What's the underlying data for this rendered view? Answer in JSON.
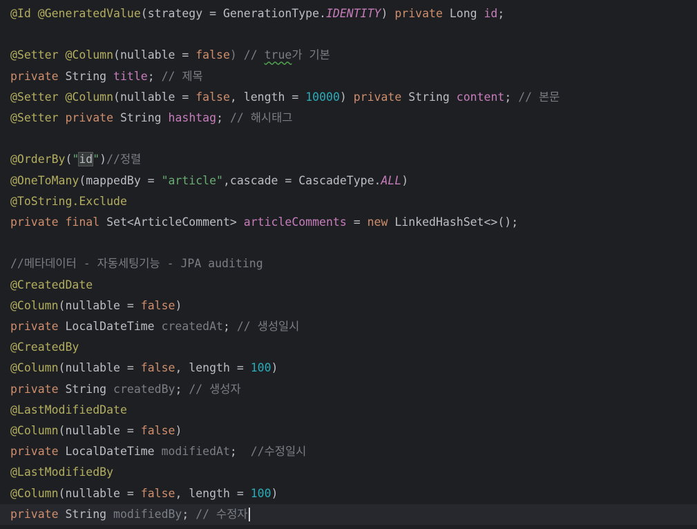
{
  "editor": {
    "lines": [
      {
        "id": "line-id-field",
        "tokens": [
          {
            "text": "@Id",
            "type": "annotation"
          },
          {
            "text": " ",
            "type": "plain"
          },
          {
            "text": "@GeneratedValue",
            "type": "annotation"
          },
          {
            "text": "(strategy = GenerationType.",
            "type": "plain"
          },
          {
            "text": "IDENTITY",
            "type": "static"
          },
          {
            "text": ") ",
            "type": "plain"
          },
          {
            "text": "private",
            "type": "keyword"
          },
          {
            "text": " Long ",
            "type": "plain"
          },
          {
            "text": "id",
            "type": "field"
          },
          {
            "text": ";",
            "type": "plain"
          }
        ]
      },
      {
        "id": "blank-1",
        "tokens": []
      },
      {
        "id": "line-setter-column",
        "tokens": [
          {
            "text": "@Setter",
            "type": "annotation"
          },
          {
            "text": " ",
            "type": "plain"
          },
          {
            "text": "@Column",
            "type": "annotation"
          },
          {
            "text": "(nullable = ",
            "type": "plain"
          },
          {
            "text": "false",
            "type": "keyword"
          },
          {
            "text": ") // ",
            "type": "comment"
          },
          {
            "text": "true",
            "type": "comment",
            "typo": true
          },
          {
            "text": "가 기본",
            "type": "comment"
          }
        ]
      },
      {
        "id": "line-title-field",
        "tokens": [
          {
            "text": "private",
            "type": "keyword"
          },
          {
            "text": " String ",
            "type": "plain"
          },
          {
            "text": "title",
            "type": "field"
          },
          {
            "text": "; ",
            "type": "plain"
          },
          {
            "text": "// 제목",
            "type": "comment"
          }
        ]
      },
      {
        "id": "line-content-field",
        "tokens": [
          {
            "text": "@Setter",
            "type": "annotation"
          },
          {
            "text": " ",
            "type": "plain"
          },
          {
            "text": "@Column",
            "type": "annotation"
          },
          {
            "text": "(nullable = ",
            "type": "plain"
          },
          {
            "text": "false",
            "type": "keyword"
          },
          {
            "text": ", length = ",
            "type": "plain"
          },
          {
            "text": "10000",
            "type": "number"
          },
          {
            "text": ") ",
            "type": "plain"
          },
          {
            "text": "private",
            "type": "keyword"
          },
          {
            "text": " String ",
            "type": "plain"
          },
          {
            "text": "content",
            "type": "field"
          },
          {
            "text": "; ",
            "type": "plain"
          },
          {
            "text": "// 본문",
            "type": "comment"
          }
        ]
      },
      {
        "id": "line-hashtag-field",
        "tokens": [
          {
            "text": "@Setter",
            "type": "annotation"
          },
          {
            "text": " ",
            "type": "plain"
          },
          {
            "text": "private",
            "type": "keyword"
          },
          {
            "text": " String ",
            "type": "plain"
          },
          {
            "text": "hashtag",
            "type": "field"
          },
          {
            "text": "; ",
            "type": "plain"
          },
          {
            "text": "// 해시태그",
            "type": "comment"
          }
        ]
      },
      {
        "id": "blank-2",
        "tokens": []
      },
      {
        "id": "line-orderby",
        "tokens": [
          {
            "text": "@OrderBy",
            "type": "annotation"
          },
          {
            "text": "(",
            "type": "plain"
          },
          {
            "text": "\"",
            "type": "string"
          },
          {
            "text": "id",
            "type": "plain",
            "highlight": true
          },
          {
            "text": "\"",
            "type": "string"
          },
          {
            "text": ")",
            "type": "plain"
          },
          {
            "text": "//정렬",
            "type": "comment"
          }
        ]
      },
      {
        "id": "line-onetomany",
        "tokens": [
          {
            "text": "@OneToMany",
            "type": "annotation"
          },
          {
            "text": "(mappedBy = ",
            "type": "plain"
          },
          {
            "text": "\"article\"",
            "type": "string"
          },
          {
            "text": ",cascade = CascadeType.",
            "type": "plain"
          },
          {
            "text": "ALL",
            "type": "static"
          },
          {
            "text": ")",
            "type": "plain"
          }
        ]
      },
      {
        "id": "line-tostring-exclude",
        "tokens": [
          {
            "text": "@ToString.Exclude",
            "type": "annotation"
          }
        ]
      },
      {
        "id": "line-article-comments",
        "tokens": [
          {
            "text": "private",
            "type": "keyword"
          },
          {
            "text": " ",
            "type": "plain"
          },
          {
            "text": "final",
            "type": "keyword"
          },
          {
            "text": " Set<ArticleComment> ",
            "type": "plain"
          },
          {
            "text": "articleComments",
            "type": "field"
          },
          {
            "text": " = ",
            "type": "plain"
          },
          {
            "text": "new",
            "type": "keyword"
          },
          {
            "text": " LinkedHashSet<>();",
            "type": "plain"
          }
        ]
      },
      {
        "id": "blank-3",
        "tokens": []
      },
      {
        "id": "line-metadata-comment",
        "tokens": [
          {
            "text": "//메타데이터 - 자동세팅기능 - JPA auditing",
            "type": "comment"
          }
        ]
      },
      {
        "id": "line-createddate",
        "tokens": [
          {
            "text": "@CreatedDate",
            "type": "annotation"
          }
        ]
      },
      {
        "id": "line-column-createdat",
        "tokens": [
          {
            "text": "@Column",
            "type": "annotation"
          },
          {
            "text": "(nullable = ",
            "type": "plain"
          },
          {
            "text": "false",
            "type": "keyword"
          },
          {
            "text": ")",
            "type": "plain"
          }
        ]
      },
      {
        "id": "line-createdat-field",
        "tokens": [
          {
            "text": "private",
            "type": "keyword"
          },
          {
            "text": " LocalDateTime ",
            "type": "plain"
          },
          {
            "text": "createdAt",
            "type": "unused"
          },
          {
            "text": "; ",
            "type": "plain"
          },
          {
            "text": "// 생성일시",
            "type": "comment"
          }
        ]
      },
      {
        "id": "line-createdby",
        "tokens": [
          {
            "text": "@CreatedBy",
            "type": "annotation"
          }
        ]
      },
      {
        "id": "line-column-createdby",
        "tokens": [
          {
            "text": "@Column",
            "type": "annotation"
          },
          {
            "text": "(nullable = ",
            "type": "plain"
          },
          {
            "text": "false",
            "type": "keyword"
          },
          {
            "text": ", length = ",
            "type": "plain"
          },
          {
            "text": "100",
            "type": "number"
          },
          {
            "text": ")",
            "type": "plain"
          }
        ]
      },
      {
        "id": "line-createdby-field",
        "tokens": [
          {
            "text": "private",
            "type": "keyword"
          },
          {
            "text": " String ",
            "type": "plain"
          },
          {
            "text": "createdBy",
            "type": "unused"
          },
          {
            "text": "; ",
            "type": "plain"
          },
          {
            "text": "// 생성자",
            "type": "comment"
          }
        ]
      },
      {
        "id": "line-lastmodifieddate",
        "tokens": [
          {
            "text": "@LastModifiedDate",
            "type": "annotation"
          }
        ]
      },
      {
        "id": "line-column-modifiedat",
        "tokens": [
          {
            "text": "@Column",
            "type": "annotation"
          },
          {
            "text": "(nullable = ",
            "type": "plain"
          },
          {
            "text": "false",
            "type": "keyword"
          },
          {
            "text": ")",
            "type": "plain"
          }
        ]
      },
      {
        "id": "line-modifiedat-field",
        "tokens": [
          {
            "text": "private",
            "type": "keyword"
          },
          {
            "text": " LocalDateTime ",
            "type": "plain"
          },
          {
            "text": "modifiedAt",
            "type": "unused"
          },
          {
            "text": ";  ",
            "type": "plain"
          },
          {
            "text": "//수정일시",
            "type": "comment"
          }
        ]
      },
      {
        "id": "line-lastmodifiedby",
        "tokens": [
          {
            "text": "@LastModifiedBy",
            "type": "annotation"
          }
        ]
      },
      {
        "id": "line-column-modifiedby",
        "tokens": [
          {
            "text": "@Column",
            "type": "annotation"
          },
          {
            "text": "(nullable = ",
            "type": "plain"
          },
          {
            "text": "false",
            "type": "keyword"
          },
          {
            "text": ", length = ",
            "type": "plain"
          },
          {
            "text": "100",
            "type": "number"
          },
          {
            "text": ")",
            "type": "plain"
          }
        ]
      },
      {
        "id": "line-modifiedby-field",
        "current": true,
        "caret": true,
        "tokens": [
          {
            "text": "private",
            "type": "keyword"
          },
          {
            "text": " String ",
            "type": "plain"
          },
          {
            "text": "modifiedBy",
            "type": "unused"
          },
          {
            "text": "; ",
            "type": "plain"
          },
          {
            "text": "// 수정자",
            "type": "comment"
          }
        ]
      }
    ]
  },
  "colors": {
    "background": "#1e1f22",
    "current_line": "#26282e",
    "annotation": "#b3ae60",
    "keyword": "#cf8e6d",
    "field": "#c77dbb",
    "string": "#6aab73",
    "number": "#2aacb8",
    "comment": "#7a7e85",
    "plain": "#bcbec4"
  }
}
